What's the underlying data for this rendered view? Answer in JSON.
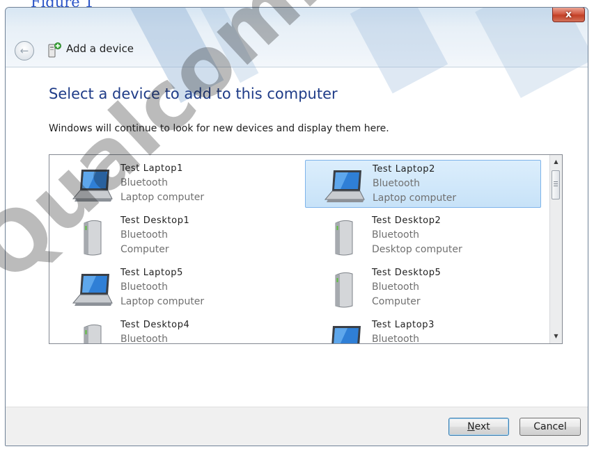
{
  "caption_text": "Figure 1",
  "window": {
    "title": "Add a device",
    "close_label": "x",
    "back_icon": "back-arrow-icon",
    "icon": "add-device-wizard-icon"
  },
  "content": {
    "heading": "Select a device to add to this computer",
    "description": "Windows will continue to look for new devices and display them here."
  },
  "devices": [
    {
      "name": "Test Laptop1",
      "connection": "Bluetooth",
      "type": "Laptop computer",
      "icon": "laptop-icon",
      "selected": false
    },
    {
      "name": "Test Laptop2",
      "connection": "Bluetooth",
      "type": "Laptop computer",
      "icon": "laptop-icon",
      "selected": true
    },
    {
      "name": "Test Desktop1",
      "connection": "Bluetooth",
      "type": "Computer",
      "icon": "desktop-tower-icon",
      "selected": false
    },
    {
      "name": "Test Desktop2",
      "connection": "Bluetooth",
      "type": "Desktop computer",
      "icon": "desktop-tower-icon",
      "selected": false
    },
    {
      "name": "Test Laptop5",
      "connection": "Bluetooth",
      "type": "Laptop computer",
      "icon": "laptop-icon",
      "selected": false
    },
    {
      "name": "Test Desktop5",
      "connection": "Bluetooth",
      "type": "Computer",
      "icon": "desktop-tower-icon",
      "selected": false
    },
    {
      "name": "Test Desktop4",
      "connection": "Bluetooth",
      "type": "",
      "icon": "desktop-tower-icon",
      "selected": false
    },
    {
      "name": "Test Laptop3",
      "connection": "Bluetooth",
      "type": "",
      "icon": "laptop-icon",
      "selected": false
    }
  ],
  "buttons": {
    "next_mnemonic": "N",
    "next_rest": "ext",
    "cancel": "Cancel"
  },
  "watermark": "Qualcomm Athe",
  "colors": {
    "heading": "#1f3c88",
    "selection": "#c7e2f8",
    "selection_border": "#7eb4ea",
    "close_button": "#c9472d",
    "caption": "#2a54c8"
  }
}
